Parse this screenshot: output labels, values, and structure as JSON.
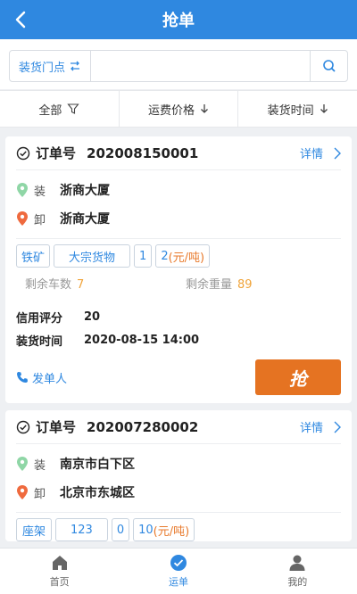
{
  "header": {
    "title": "抢单"
  },
  "search": {
    "location_label": "装货门点",
    "placeholder": ""
  },
  "filters": {
    "all": "全部",
    "price": "运费价格",
    "time": "装货时间"
  },
  "orders": [
    {
      "order_label": "订单号",
      "order_no": "202008150001",
      "detail_label": "详情",
      "load_tag": "装",
      "load_place": "浙商大厦",
      "unload_tag": "卸",
      "unload_place": "浙商大厦",
      "tags": {
        "t1": "铁矿",
        "t2": "大宗货物",
        "t3": "1",
        "t4_value": "2",
        "t4_unit": "(元/吨)"
      },
      "remain_cars_label": "剩余车数",
      "remain_cars": "7",
      "remain_weight_label": "剩余重量",
      "remain_weight": "89",
      "credit_label": "信用评分",
      "credit": "20",
      "load_time_label": "装货时间",
      "load_time": "2020-08-15 14:00",
      "sender_label": "发单人",
      "grab_label": "抢"
    },
    {
      "order_label": "订单号",
      "order_no": "202007280002",
      "detail_label": "详情",
      "load_tag": "装",
      "load_place": "南京市白下区",
      "unload_tag": "卸",
      "unload_place": "北京市东城区",
      "tags": {
        "t1": "座架",
        "t3": "123",
        "t4": "0",
        "t5_value": "10",
        "t5_unit": "(元/吨)"
      }
    }
  ],
  "tabbar": {
    "home": "首页",
    "waybill": "运单",
    "mine": "我的"
  },
  "colors": {
    "primary": "#2f88e0",
    "accent": "#e57322"
  }
}
